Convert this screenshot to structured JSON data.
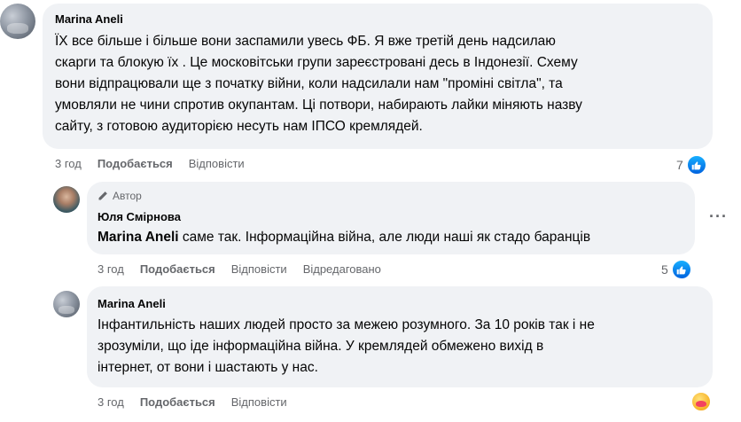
{
  "comments": [
    {
      "author": "Marina Aneli",
      "lines": [
        "ЇХ все більше і більше вони заспамили увесь ФБ. Я вже третій день надсилаю",
        "скарги та блокую їх . Це московітськи групи зареєстровані десь в Індонезії. Схему",
        "вони відпрацювали ще з початку війни, коли надсилали нам \"проміні світла\", та",
        "умовляли не чини спротив окупантам. Ці потвори, набирають лайки міняють назву",
        "сайту, з готовою аудиторією несуть нам ІПСО кремлядей."
      ],
      "time": "3 год",
      "like_label": "Подобається",
      "reply_label": "Відповісти",
      "reaction_count": "7"
    },
    {
      "badge": "Автор",
      "author": "Юля Смірнова",
      "mention": "Marina Aneli",
      "text": " саме так. Інформаційна війна, але люди наші як стадо баранців",
      "time": "3 год",
      "like_label": "Подобається",
      "reply_label": "Відповісти",
      "edited_label": "Відредаговано",
      "reaction_count": "5"
    },
    {
      "author": "Marina Aneli",
      "lines": [
        "Інфантильність наших людей просто за межею розумного. За 10 років так і не",
        "зрозуміли, що іде інформаційна війна. У кремлядей обмежено вихід в",
        "інтернет, от вони і шастають у нас."
      ],
      "time": "3 год",
      "like_label": "Подобається",
      "reply_label": "Відповісти"
    }
  ],
  "icons": {
    "like": "thumbs-up-icon",
    "more": "more-options-icon",
    "author_badge": "pencil-icon",
    "care": "care-reaction-icon"
  },
  "colors": {
    "bubble": "#f0f2f5",
    "secondary_text": "#65676b",
    "like_blue": "#0866ff"
  }
}
